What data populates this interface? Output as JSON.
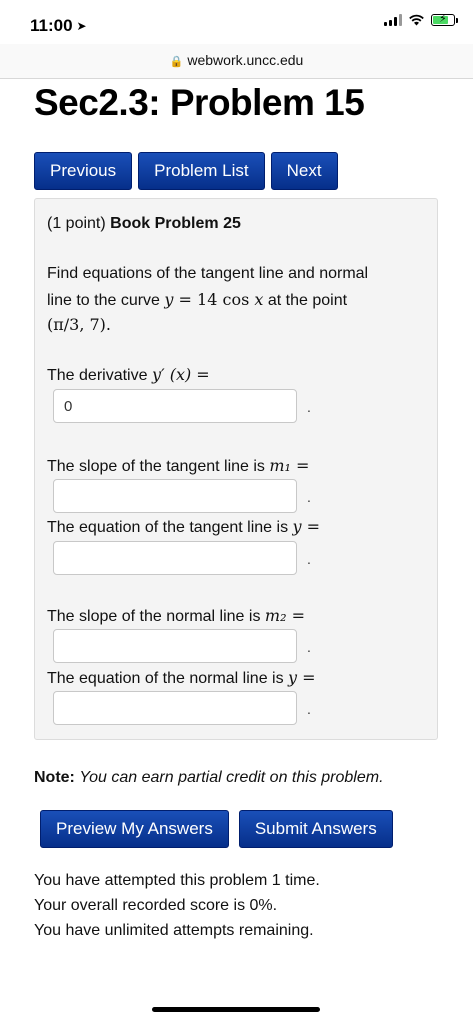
{
  "status_bar": {
    "time": "11:00"
  },
  "browser": {
    "url": "webwork.uncc.edu"
  },
  "page": {
    "title": "Sec2.3: Problem 15"
  },
  "nav": {
    "previous": "Previous",
    "problem_list": "Problem List",
    "next": "Next"
  },
  "problem": {
    "points": "(1 point)",
    "book_ref": "Book Problem 25",
    "intro_line1": "Find equations of the tangent line and normal",
    "intro_line2_prefix": "line to the curve",
    "intro_line2_suffix": "at the point",
    "curve_lhs": "y",
    "curve_eq": " = 14 cos ",
    "curve_var": "x",
    "point": "(π/3, 7).",
    "q1_label": "The derivative",
    "q1_math": "y′ (x) =",
    "q1_value": "0",
    "q2_label": "The slope of the tangent line is",
    "q2_math": "m₁ =",
    "q2_value": "",
    "q3_label": "The equation of the tangent line is",
    "q3_math": "y =",
    "q3_value": "",
    "q4_label": "The slope of the normal line is",
    "q4_math": "m₂ =",
    "q4_value": "",
    "q5_label": "The equation of the normal line is",
    "q5_math": "y =",
    "q5_value": "",
    "period": "."
  },
  "note": {
    "label": "Note:",
    "text": "You can earn partial credit on this problem."
  },
  "actions": {
    "preview": "Preview My Answers",
    "submit": "Submit Answers"
  },
  "attempt_info": {
    "line1": "You have attempted this problem 1 time.",
    "line2": "Your overall recorded score is 0%.",
    "line3": "You have unlimited attempts remaining."
  },
  "icons": {
    "lock": "lock-icon",
    "location": "location-arrow-icon",
    "wifi": "wifi-icon",
    "battery": "battery-charging-icon"
  },
  "colors": {
    "button_bg": "#0a3aa0",
    "problem_box_bg": "#f4f4f4"
  }
}
